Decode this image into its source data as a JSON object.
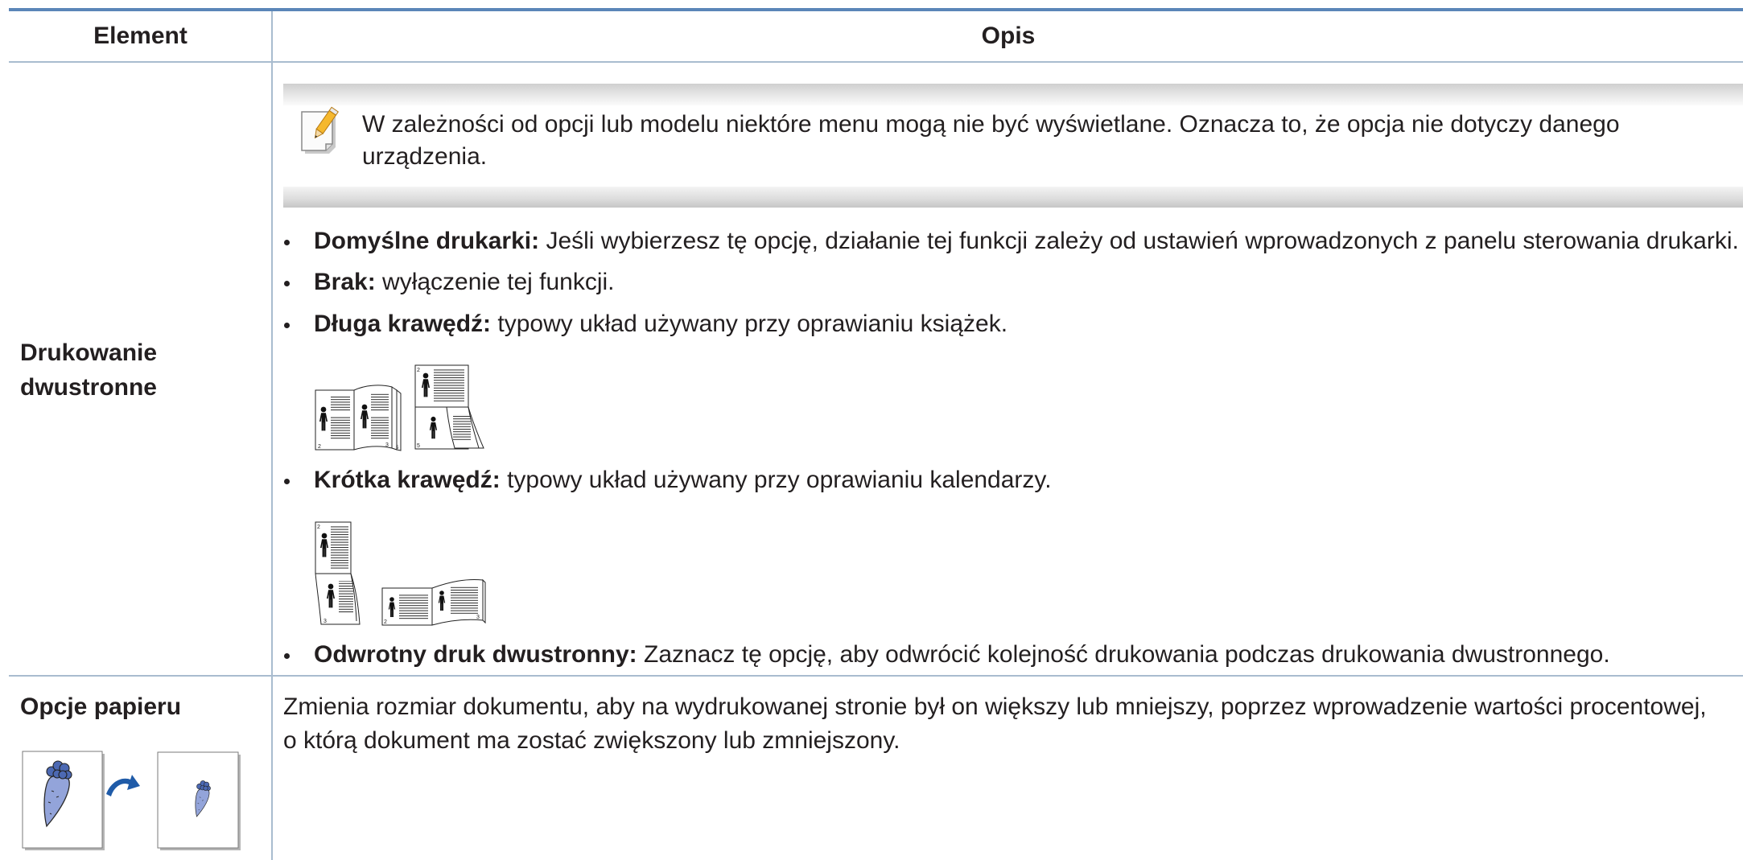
{
  "table": {
    "headers": {
      "element": "Element",
      "description": "Opis"
    },
    "duplex_row": {
      "element": "Drukowanie dwustronne",
      "note": {
        "icon": "note-pencil-icon",
        "text": "W zależności od opcji lub modelu niektóre menu mogą nie być wyświetlane. Oznacza to, że opcja nie dotyczy danego urządzenia."
      },
      "options": [
        {
          "label": "Domyślne drukarki:",
          "text": "Jeśli wybierzesz tę opcję, działanie tej funkcji zależy od ustawień wprowadzonych z panelu sterowania drukarki."
        },
        {
          "label": "Brak:",
          "text": "wyłączenie tej funkcji."
        },
        {
          "label": "Długa krawędź:",
          "text": "typowy układ używany przy oprawianiu książek.",
          "illustration": "long-edge-binding-illustration",
          "page_numbers": [
            "2",
            "3",
            "5",
            "2",
            "5"
          ]
        },
        {
          "label": "Krótka krawędź:",
          "text": "typowy układ używany przy oprawianiu kalendarzy.",
          "illustration": "short-edge-binding-illustration",
          "page_numbers": [
            "2",
            "3",
            "2",
            "3"
          ]
        },
        {
          "label": "Odwrotny druk dwustronny:",
          "text": "Zaznacz tę opcję, aby odwrócić kolejność drukowania podczas drukowania dwustronnego."
        }
      ]
    },
    "paper_row": {
      "element": "Opcje papieru",
      "text": "Zmienia rozmiar dokumentu, aby na wydrukowanej stronie był on większy lub mniejszy, poprzez wprowadzenie wartości procentowej, o którą dokument ma zostać zwiększony lub zmniejszony.",
      "illustration": "page-scaling-illustration",
      "icons": [
        "carrot-icon",
        "scale-arrow-icon"
      ]
    }
  },
  "colors": {
    "header_rule": "#5b86b8",
    "grid_lines": "#a9bccf",
    "text": "#231f20",
    "pencil": "#f5b82e",
    "carrot": "#93a4da",
    "arrow": "#1f5ba8"
  }
}
